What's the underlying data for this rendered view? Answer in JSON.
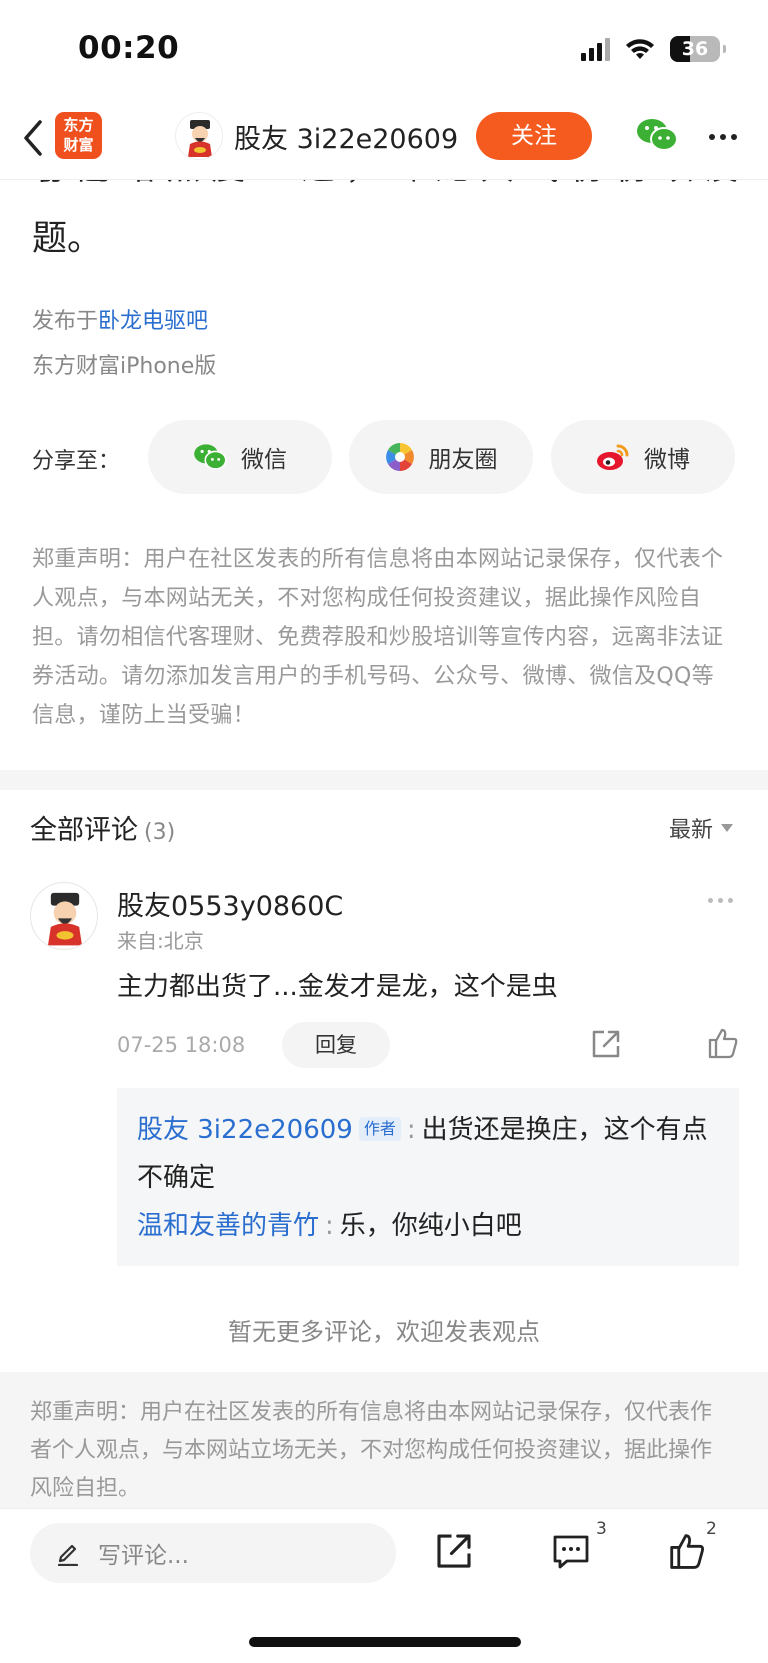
{
  "status_bar": {
    "time": "00:20",
    "battery": "36"
  },
  "header": {
    "app_logo_line1": "东方",
    "app_logo_line2": "财富",
    "username": "股友 3i22e20609",
    "follow_label": "关注"
  },
  "article": {
    "tail_text": "题。",
    "published_prefix": "发布于",
    "forum_name": "卧龙电驱吧",
    "client": "东方财富iPhone版"
  },
  "share": {
    "label": "分享至：",
    "buttons": [
      {
        "label": "微信",
        "icon": "wechat-icon"
      },
      {
        "label": "朋友圈",
        "icon": "moments-icon"
      },
      {
        "label": "微博",
        "icon": "weibo-icon"
      }
    ]
  },
  "disclaimer": "郑重声明：用户在社区发表的所有信息将由本网站记录保存，仅代表个人观点，与本网站无关，不对您构成任何投资建议，据此操作风险自担。请勿相信代客理财、免费荐股和炒股培训等宣传内容，远离非法证券活动。请勿添加发言用户的手机号码、公众号、微博、微信及QQ等信息，谨防上当受骗！",
  "comments": {
    "title": "全部评论",
    "count": "(3)",
    "sort_label": "最新",
    "items": [
      {
        "user": "股友0553y0860C",
        "location": "来自:北京",
        "body": "主力都出货了...金发才是龙，这个是虫",
        "time": "07-25 18:08",
        "reply_label": "回复",
        "replies": [
          {
            "user": "股友 3i22e20609",
            "tag": "作者",
            "text": "出货还是换庄，这个有点不确定"
          },
          {
            "user": "温和友善的青竹",
            "text": "乐，你纯小白吧"
          }
        ]
      }
    ],
    "no_more": "暂无更多评论，欢迎发表观点"
  },
  "footer_disclaimer": "郑重声明：用户在社区发表的所有信息将由本网站记录保存，仅代表作者个人观点，与本网站立场无关，不对您构成任何投资建议，据此操作风险自担。",
  "bottom_bar": {
    "write_placeholder": "写评论...",
    "comment_count": "3",
    "like_count": "2"
  },
  "colors": {
    "accent": "#f55a1e",
    "link": "#2a6ecf",
    "wechat_green": "#3cb034"
  }
}
